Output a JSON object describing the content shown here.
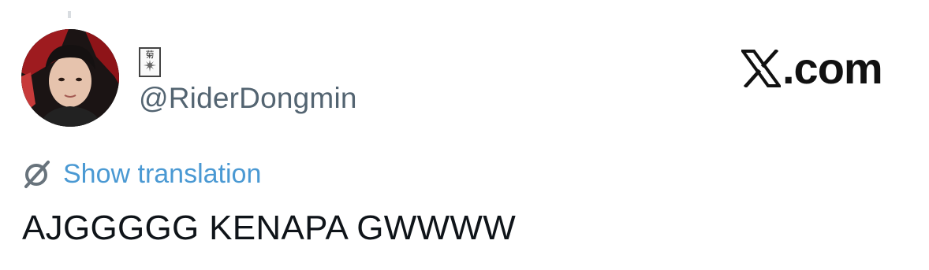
{
  "author": {
    "display_name_glyph": "菊",
    "handle": "@RiderDongmin",
    "avatar": "avatar-photo"
  },
  "brand": {
    "logo_icon": "x-logo-icon",
    "text": ".com"
  },
  "translation": {
    "icon": "globe-slash-icon",
    "label": "Show translation"
  },
  "tweet": {
    "text": "AJGGGGG KENAPA GWWWW"
  },
  "colors": {
    "link": "#4a99d3",
    "handle": "#536471",
    "text": "#0f1419"
  }
}
